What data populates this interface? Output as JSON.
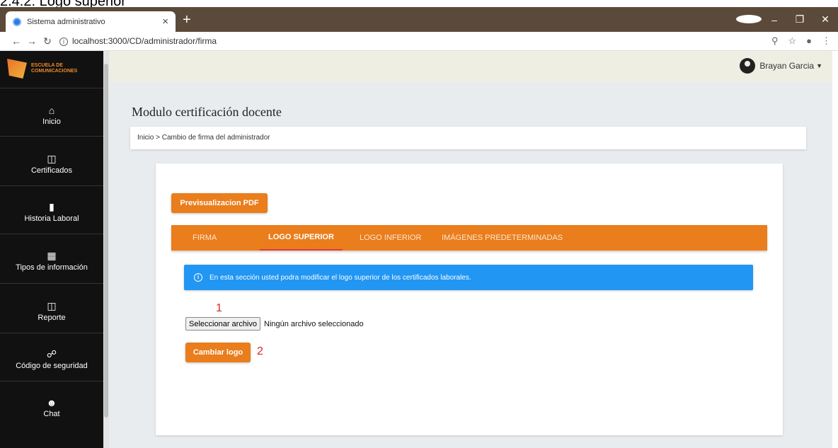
{
  "doc_heading": "2.4.2. Logo superior",
  "browser": {
    "tab_title": "Sistema administrativo",
    "tab_close": "×",
    "new_tab": "+",
    "url": "localhost:3000/CD/administrador/firma"
  },
  "sidebar": {
    "logo_line1": "ESCUELA DE",
    "logo_line2": "COMUNICACIONES",
    "items": [
      {
        "label": "Inicio",
        "icon": "home-icon"
      },
      {
        "label": "Certificados",
        "icon": "book-icon"
      },
      {
        "label": "Historia Laboral",
        "icon": "document-icon"
      },
      {
        "label": "Tipos de información",
        "icon": "id-card-icon"
      },
      {
        "label": "Reporte",
        "icon": "report-icon"
      },
      {
        "label": "Código de seguridad",
        "icon": "lock-icon"
      },
      {
        "label": "Chat",
        "icon": "chat-icon"
      }
    ]
  },
  "header": {
    "user_name": "Brayan Garcia"
  },
  "main": {
    "page_title": "Modulo certificación docente",
    "breadcrumb": "Inicio > Cambio de firma del administrador",
    "preview_button": "Previsualizacion PDF",
    "tabs": [
      {
        "label": "FIRMA",
        "active": false
      },
      {
        "label": "LOGO SUPERIOR",
        "active": true
      },
      {
        "label": "LOGO INFERIOR",
        "active": false
      },
      {
        "label": "IMÁGENES PREDETERMINADAS",
        "active": false
      }
    ],
    "alert_text": "En esta sección usted podra modificar el logo superior de los certificados laborales.",
    "marker_1": "1",
    "file_button": "Seleccionar archivo",
    "file_status": "Ningún archivo seleccionado",
    "change_button": "Cambiar logo",
    "marker_2": "2"
  },
  "colors": {
    "accent": "#ea7d1c",
    "info": "#2196f3",
    "sidebar": "#111111",
    "marker": "#d62828"
  }
}
